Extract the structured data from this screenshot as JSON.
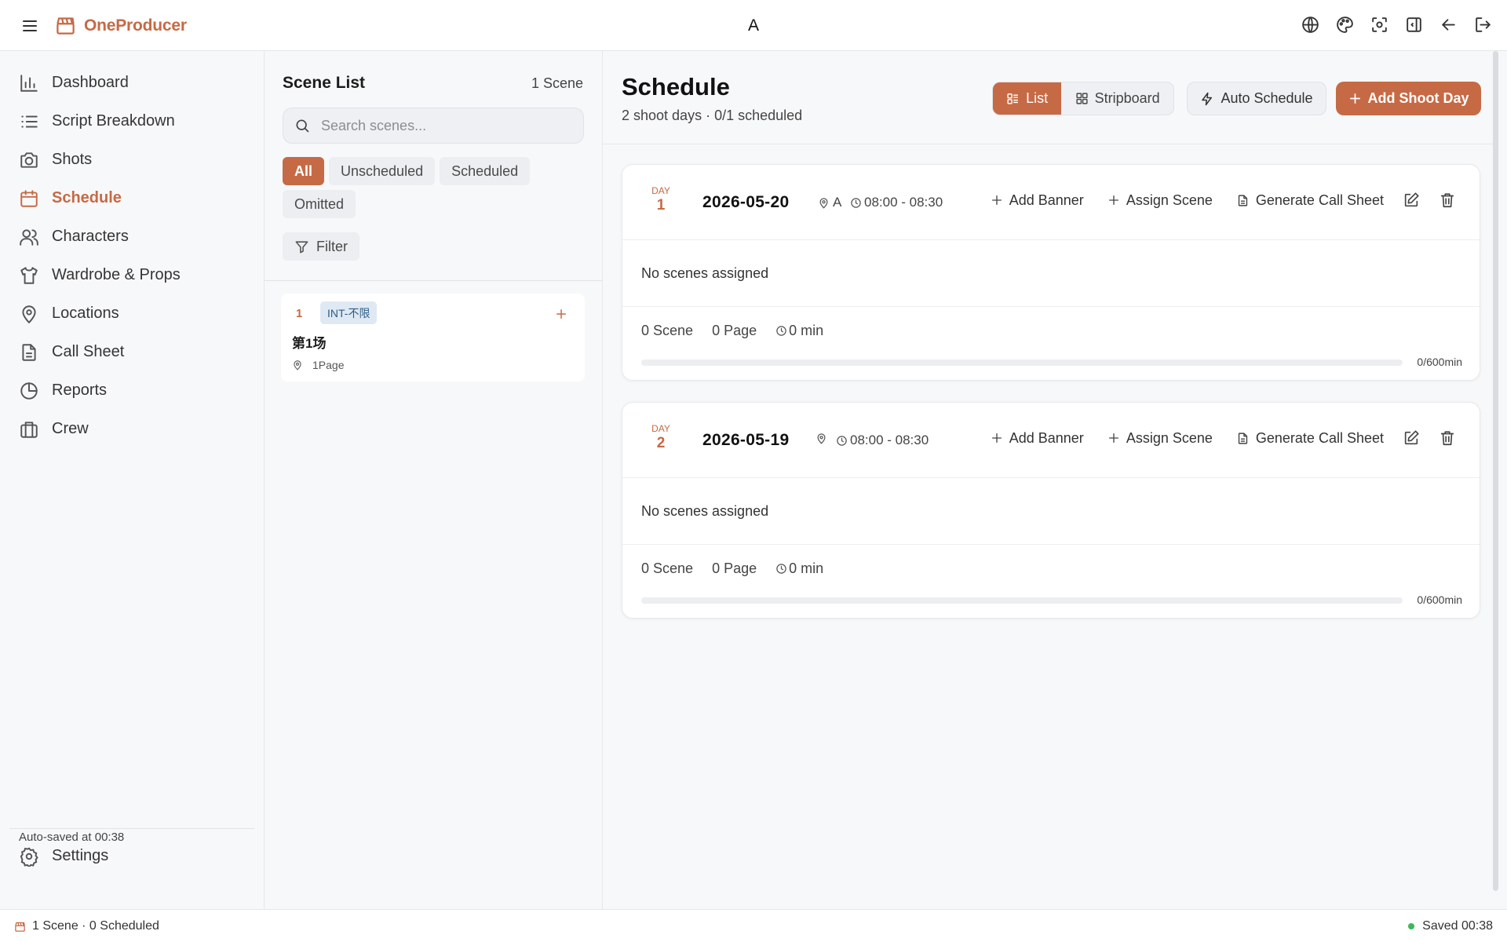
{
  "app": {
    "name": "OneProducer",
    "project": "A"
  },
  "colors": {
    "accent": "#c66a45",
    "success": "#3bb85a",
    "tag_bg": "#dfe9f3",
    "tag_text": "#2f5b86"
  },
  "topbar": {
    "icons": [
      "globe-icon",
      "palette-icon",
      "focus-icon",
      "panel-icon",
      "back-arrow-icon",
      "logout-icon"
    ]
  },
  "sidebar": {
    "items": [
      {
        "label": "Dashboard",
        "icon": "bar-chart-icon"
      },
      {
        "label": "Script Breakdown",
        "icon": "list-icon"
      },
      {
        "label": "Shots",
        "icon": "camera-icon"
      },
      {
        "label": "Schedule",
        "icon": "calendar-icon",
        "active": true
      },
      {
        "label": "Characters",
        "icon": "users-icon"
      },
      {
        "label": "Wardrobe & Props",
        "icon": "shirt-icon"
      },
      {
        "label": "Locations",
        "icon": "map-pin-icon"
      },
      {
        "label": "Call Sheet",
        "icon": "file-text-icon"
      },
      {
        "label": "Reports",
        "icon": "pie-chart-icon"
      },
      {
        "label": "Crew",
        "icon": "briefcase-icon"
      }
    ],
    "settings_label": "Settings",
    "autosave_text": "Auto-saved at 00:38"
  },
  "scene_panel": {
    "title": "Scene List",
    "count": "1 Scene",
    "search_placeholder": "Search scenes...",
    "chips": [
      "All",
      "Unscheduled",
      "Scheduled",
      "Omitted"
    ],
    "active_chip": "All",
    "filter_label": "Filter",
    "scenes": [
      {
        "number": "1",
        "tag": "INT-不限",
        "name": "第1场",
        "pages": "1Page"
      }
    ]
  },
  "main": {
    "title": "Schedule",
    "subtitle": "2 shoot days · 0/1 scheduled",
    "view_list": "List",
    "view_stripboard": "Stripboard",
    "auto_schedule": "Auto Schedule",
    "add_shoot_day": "Add Shoot Day",
    "day_word": "DAY",
    "action_add_banner": "Add Banner",
    "action_assign_scene": "Assign Scene",
    "action_call_sheet": "Generate Call Sheet",
    "no_scenes": "No scenes assigned",
    "days": [
      {
        "num": "1",
        "date": "2026-05-20",
        "location": "A",
        "time": "08:00 - 08:30",
        "scenes": "0 Scene",
        "pages": "0 Page",
        "minutes": "0 min",
        "capacity": "0/600min",
        "fill": 0
      },
      {
        "num": "2",
        "date": "2026-05-19",
        "location": "",
        "time": "08:00 - 08:30",
        "scenes": "0 Scene",
        "pages": "0 Page",
        "minutes": "0 min",
        "capacity": "0/600min",
        "fill": 0
      }
    ]
  },
  "statusbar": {
    "left": "1 Scene · 0 Scheduled",
    "right": "Saved 00:38"
  }
}
